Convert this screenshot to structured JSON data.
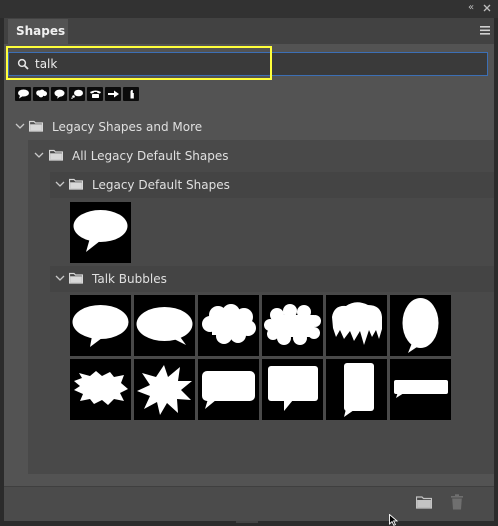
{
  "window": {
    "collapse_icon": "double-chevron-left-icon",
    "close_icon": "close-icon"
  },
  "panel": {
    "tab_label": "Shapes",
    "menu_icon": "panel-menu-icon"
  },
  "search": {
    "value": "talk",
    "placeholder": "",
    "icon": "search-icon"
  },
  "suggestions": [
    {
      "name": "talk-bubble-oval-icon"
    },
    {
      "name": "talk-bubble-cloud-icon"
    },
    {
      "name": "talk-bubble-round-icon"
    },
    {
      "name": "thought-bubble-icon"
    },
    {
      "name": "telephone-icon"
    },
    {
      "name": "arrow-right-icon"
    },
    {
      "name": "hand-icon"
    }
  ],
  "tree": {
    "root": {
      "label": "Legacy Shapes and More"
    },
    "child": {
      "label": "All Legacy Default Shapes"
    },
    "groups": [
      {
        "label": "Legacy Default Shapes",
        "shapes": [
          "talk-bubble-oval"
        ]
      },
      {
        "label": "Talk Bubbles",
        "shapes": [
          "talk-bubble-oval",
          "talk-bubble-wide",
          "talk-bubble-cloud",
          "talk-bubble-cloud-puffy",
          "talk-bubble-drip",
          "talk-bubble-tall-oval",
          "talk-bubble-jagged",
          "talk-bubble-burst",
          "talk-bubble-rect",
          "talk-bubble-rect-square",
          "talk-bubble-rect-tall",
          "talk-bubble-banner"
        ]
      }
    ]
  },
  "footer": {
    "new_folder_icon": "folder-icon",
    "delete_icon": "trash-icon"
  },
  "colors": {
    "panel_bg": "#535353",
    "highlight": "#ffff3b",
    "focus_border": "#3c6fb5"
  }
}
